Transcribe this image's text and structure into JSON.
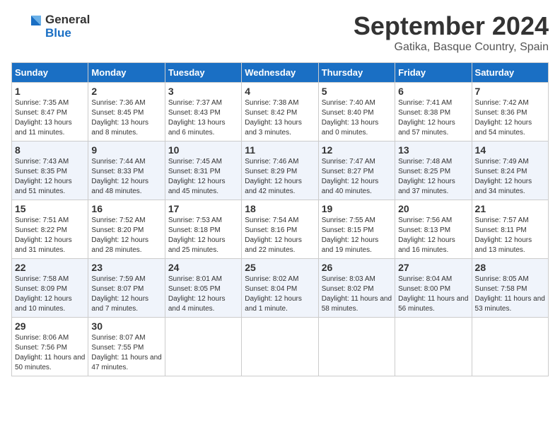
{
  "header": {
    "logo_general": "General",
    "logo_blue": "Blue",
    "month_title": "September 2024",
    "location": "Gatika, Basque Country, Spain"
  },
  "columns": [
    "Sunday",
    "Monday",
    "Tuesday",
    "Wednesday",
    "Thursday",
    "Friday",
    "Saturday"
  ],
  "weeks": [
    [
      {
        "day": "1",
        "sunrise": "Sunrise: 7:35 AM",
        "sunset": "Sunset: 8:47 PM",
        "daylight": "Daylight: 13 hours and 11 minutes."
      },
      {
        "day": "2",
        "sunrise": "Sunrise: 7:36 AM",
        "sunset": "Sunset: 8:45 PM",
        "daylight": "Daylight: 13 hours and 8 minutes."
      },
      {
        "day": "3",
        "sunrise": "Sunrise: 7:37 AM",
        "sunset": "Sunset: 8:43 PM",
        "daylight": "Daylight: 13 hours and 6 minutes."
      },
      {
        "day": "4",
        "sunrise": "Sunrise: 7:38 AM",
        "sunset": "Sunset: 8:42 PM",
        "daylight": "Daylight: 13 hours and 3 minutes."
      },
      {
        "day": "5",
        "sunrise": "Sunrise: 7:40 AM",
        "sunset": "Sunset: 8:40 PM",
        "daylight": "Daylight: 13 hours and 0 minutes."
      },
      {
        "day": "6",
        "sunrise": "Sunrise: 7:41 AM",
        "sunset": "Sunset: 8:38 PM",
        "daylight": "Daylight: 12 hours and 57 minutes."
      },
      {
        "day": "7",
        "sunrise": "Sunrise: 7:42 AM",
        "sunset": "Sunset: 8:36 PM",
        "daylight": "Daylight: 12 hours and 54 minutes."
      }
    ],
    [
      {
        "day": "8",
        "sunrise": "Sunrise: 7:43 AM",
        "sunset": "Sunset: 8:35 PM",
        "daylight": "Daylight: 12 hours and 51 minutes."
      },
      {
        "day": "9",
        "sunrise": "Sunrise: 7:44 AM",
        "sunset": "Sunset: 8:33 PM",
        "daylight": "Daylight: 12 hours and 48 minutes."
      },
      {
        "day": "10",
        "sunrise": "Sunrise: 7:45 AM",
        "sunset": "Sunset: 8:31 PM",
        "daylight": "Daylight: 12 hours and 45 minutes."
      },
      {
        "day": "11",
        "sunrise": "Sunrise: 7:46 AM",
        "sunset": "Sunset: 8:29 PM",
        "daylight": "Daylight: 12 hours and 42 minutes."
      },
      {
        "day": "12",
        "sunrise": "Sunrise: 7:47 AM",
        "sunset": "Sunset: 8:27 PM",
        "daylight": "Daylight: 12 hours and 40 minutes."
      },
      {
        "day": "13",
        "sunrise": "Sunrise: 7:48 AM",
        "sunset": "Sunset: 8:25 PM",
        "daylight": "Daylight: 12 hours and 37 minutes."
      },
      {
        "day": "14",
        "sunrise": "Sunrise: 7:49 AM",
        "sunset": "Sunset: 8:24 PM",
        "daylight": "Daylight: 12 hours and 34 minutes."
      }
    ],
    [
      {
        "day": "15",
        "sunrise": "Sunrise: 7:51 AM",
        "sunset": "Sunset: 8:22 PM",
        "daylight": "Daylight: 12 hours and 31 minutes."
      },
      {
        "day": "16",
        "sunrise": "Sunrise: 7:52 AM",
        "sunset": "Sunset: 8:20 PM",
        "daylight": "Daylight: 12 hours and 28 minutes."
      },
      {
        "day": "17",
        "sunrise": "Sunrise: 7:53 AM",
        "sunset": "Sunset: 8:18 PM",
        "daylight": "Daylight: 12 hours and 25 minutes."
      },
      {
        "day": "18",
        "sunrise": "Sunrise: 7:54 AM",
        "sunset": "Sunset: 8:16 PM",
        "daylight": "Daylight: 12 hours and 22 minutes."
      },
      {
        "day": "19",
        "sunrise": "Sunrise: 7:55 AM",
        "sunset": "Sunset: 8:15 PM",
        "daylight": "Daylight: 12 hours and 19 minutes."
      },
      {
        "day": "20",
        "sunrise": "Sunrise: 7:56 AM",
        "sunset": "Sunset: 8:13 PM",
        "daylight": "Daylight: 12 hours and 16 minutes."
      },
      {
        "day": "21",
        "sunrise": "Sunrise: 7:57 AM",
        "sunset": "Sunset: 8:11 PM",
        "daylight": "Daylight: 12 hours and 13 minutes."
      }
    ],
    [
      {
        "day": "22",
        "sunrise": "Sunrise: 7:58 AM",
        "sunset": "Sunset: 8:09 PM",
        "daylight": "Daylight: 12 hours and 10 minutes."
      },
      {
        "day": "23",
        "sunrise": "Sunrise: 7:59 AM",
        "sunset": "Sunset: 8:07 PM",
        "daylight": "Daylight: 12 hours and 7 minutes."
      },
      {
        "day": "24",
        "sunrise": "Sunrise: 8:01 AM",
        "sunset": "Sunset: 8:05 PM",
        "daylight": "Daylight: 12 hours and 4 minutes."
      },
      {
        "day": "25",
        "sunrise": "Sunrise: 8:02 AM",
        "sunset": "Sunset: 8:04 PM",
        "daylight": "Daylight: 12 hours and 1 minute."
      },
      {
        "day": "26",
        "sunrise": "Sunrise: 8:03 AM",
        "sunset": "Sunset: 8:02 PM",
        "daylight": "Daylight: 11 hours and 58 minutes."
      },
      {
        "day": "27",
        "sunrise": "Sunrise: 8:04 AM",
        "sunset": "Sunset: 8:00 PM",
        "daylight": "Daylight: 11 hours and 56 minutes."
      },
      {
        "day": "28",
        "sunrise": "Sunrise: 8:05 AM",
        "sunset": "Sunset: 7:58 PM",
        "daylight": "Daylight: 11 hours and 53 minutes."
      }
    ],
    [
      {
        "day": "29",
        "sunrise": "Sunrise: 8:06 AM",
        "sunset": "Sunset: 7:56 PM",
        "daylight": "Daylight: 11 hours and 50 minutes."
      },
      {
        "day": "30",
        "sunrise": "Sunrise: 8:07 AM",
        "sunset": "Sunset: 7:55 PM",
        "daylight": "Daylight: 11 hours and 47 minutes."
      },
      null,
      null,
      null,
      null,
      null
    ]
  ]
}
